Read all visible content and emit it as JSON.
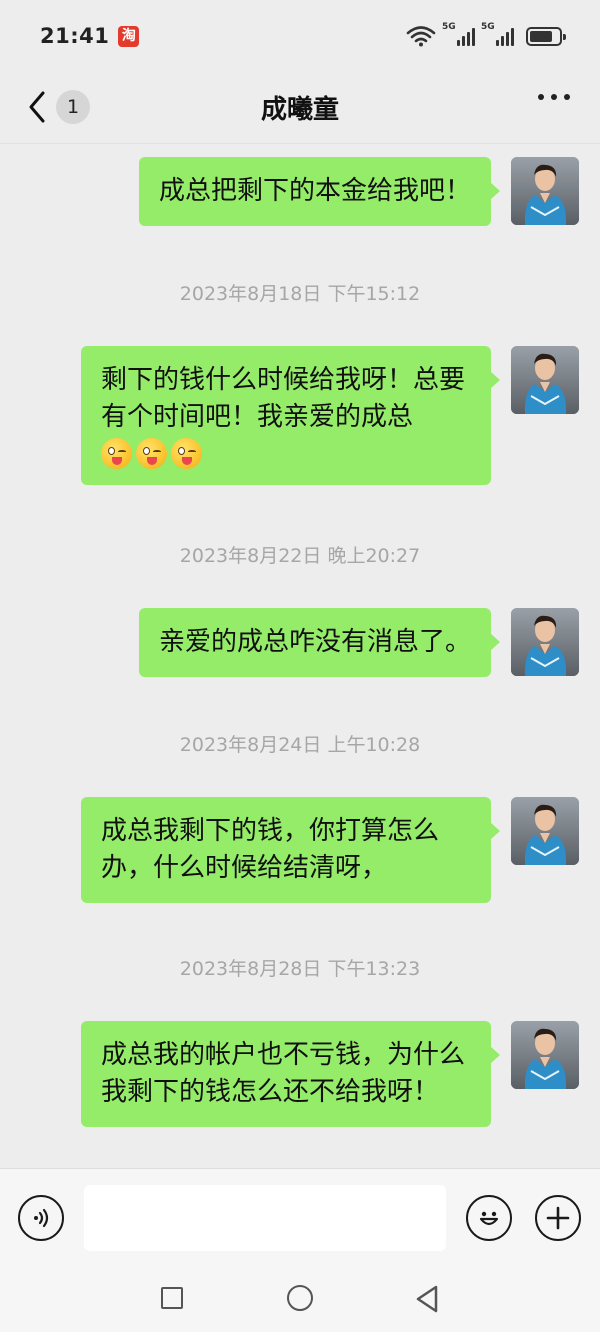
{
  "status_bar": {
    "time": "21:41",
    "badge": "淘",
    "signal_1": "5G",
    "signal_2": "5G",
    "battery_level": 0.8
  },
  "nav": {
    "unread": "1",
    "title": "成曦童"
  },
  "messages": [
    {
      "type": "message",
      "text": "成总把剩下的本金给我吧！"
    },
    {
      "type": "timestamp",
      "text": "2023年8月18日 下午15:12"
    },
    {
      "type": "message",
      "text": "剩下的钱什么时候给我呀！总要有个时间吧！我亲爱的成总",
      "emojis": [
        "wink-tongue",
        "wink-tongue",
        "wink-tongue"
      ]
    },
    {
      "type": "timestamp",
      "text": "2023年8月22日 晚上20:27"
    },
    {
      "type": "message",
      "text": "亲爱的成总咋没有消息了。"
    },
    {
      "type": "timestamp",
      "text": "2023年8月24日 上午10:28"
    },
    {
      "type": "message",
      "text": "成总我剩下的钱，你打算怎么办，什么时候给结清呀，"
    },
    {
      "type": "timestamp",
      "text": "2023年8月28日 下午13:23"
    },
    {
      "type": "message",
      "text": "成总我的帐户也不亏钱，为什么我剩下的钱怎么还不给我呀！"
    }
  ],
  "input": {
    "value": "",
    "placeholder": ""
  },
  "colors": {
    "bubble": "#95ec69",
    "background": "#ededed",
    "timestamp": "#a6a6a6"
  }
}
